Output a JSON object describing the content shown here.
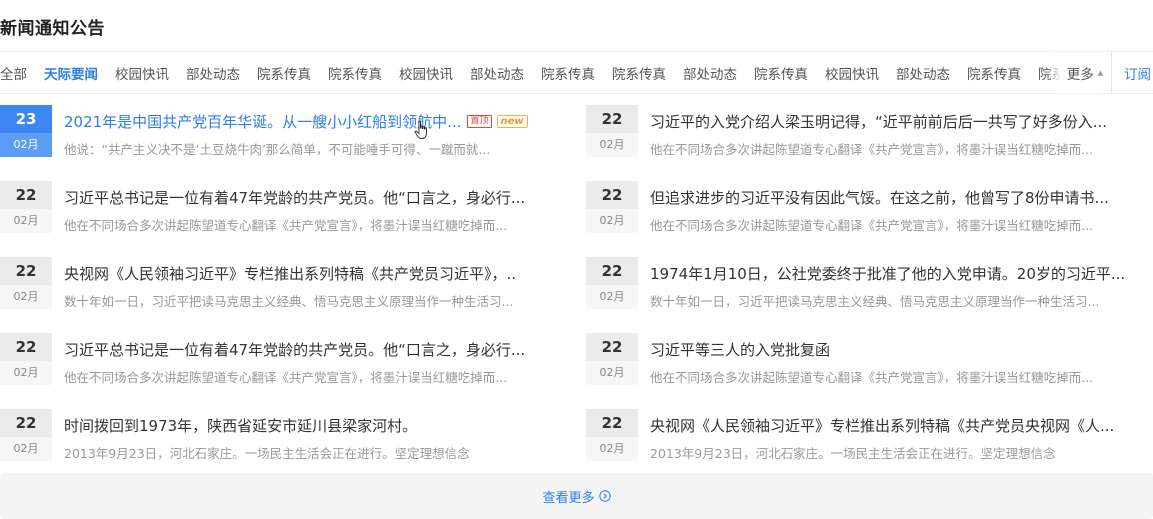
{
  "section_title": "新闻通知公告",
  "tabs": [
    "全部",
    "天际要闻",
    "校园快讯",
    "部处动态",
    "院系传真",
    "院系传真",
    "校园快讯",
    "部处动态",
    "院系传真",
    "院系传真",
    "部处动态",
    "院系传真",
    "校园快讯",
    "部处动态",
    "院系传真",
    "院系传真"
  ],
  "active_tab_index": 1,
  "more_label": "更多",
  "subscribe_label": "订阅",
  "badges": {
    "top": "置顶",
    "new": "new"
  },
  "news": [
    {
      "day": "23",
      "month": "02月",
      "title": "2021年是中国共产党百年华诞。从一艘小小红船到领航中...",
      "summary": "他说：“共产主义决不是‘土豆烧牛肉’那么简单，不可能唾手可得、一蹴而就...",
      "highlight": true,
      "link": true,
      "badges": [
        "top",
        "new"
      ]
    },
    {
      "day": "22",
      "month": "02月",
      "title": "习近平的入党介绍人梁玉明记得，“近平前前后后一共写了好多份入...",
      "summary": "他在不同场合多次讲起陈望道专心翻译《共产党宣言》，将墨汁误当红糖吃掉而..."
    },
    {
      "day": "22",
      "month": "02月",
      "title": "习近平总书记是一位有着47年党龄的共产党员。他“口言之，身必行...",
      "summary": "他在不同场合多次讲起陈望道专心翻译《共产党宣言》，将墨汁误当红糖吃掉而..."
    },
    {
      "day": "22",
      "month": "02月",
      "title": "但追求进步的习近平没有因此气馁。在这之前，他曾写了8份申请书...",
      "summary": "他在不同场合多次讲起陈望道专心翻译《共产党宣言》，将墨汁误当红糖吃掉而..."
    },
    {
      "day": "22",
      "month": "02月",
      "title": "央视网《人民领袖习近平》专栏推出系列特稿《共产党员习近平》，..",
      "summary": "数十年如一日，习近平把读马克思主义经典、悟马克思主义原理当作一种生活习..."
    },
    {
      "day": "22",
      "month": "02月",
      "title": "1974年1月10日，公社党委终于批准了他的入党申请。20岁的习近平...",
      "summary": "数十年如一日，习近平把读马克思主义经典、悟马克思主义原理当作一种生活习..."
    },
    {
      "day": "22",
      "month": "02月",
      "title": "习近平总书记是一位有着47年党龄的共产党员。他“口言之，身必行...",
      "summary": "他在不同场合多次讲起陈望道专心翻译《共产党宣言》，将墨汁误当红糖吃掉而..."
    },
    {
      "day": "22",
      "month": "02月",
      "title": "习近平等三人的入党批复函",
      "summary": "他在不同场合多次讲起陈望道专心翻译《共产党宣言》，将墨汁误当红糖吃掉而..."
    },
    {
      "day": "22",
      "month": "02月",
      "title": "时间拨回到1973年，陕西省延安市延川县梁家河村。",
      "summary": "2013年9月23日，河北石家庄。一场民主生活会正在进行。坚定理想信念"
    },
    {
      "day": "22",
      "month": "02月",
      "title": "央视网《人民领袖习近平》专栏推出系列特稿《共产党员央视网《人...",
      "summary": "2013年9月23日，河北石家庄。一场民主生活会正在进行。坚定理想信念"
    }
  ],
  "view_more_label": "查看更多",
  "colors": {
    "accent": "#2d7ee6",
    "highlight_date": "#3b86f2",
    "badge_top": "#e6452e",
    "badge_new": "#f19a1a"
  }
}
